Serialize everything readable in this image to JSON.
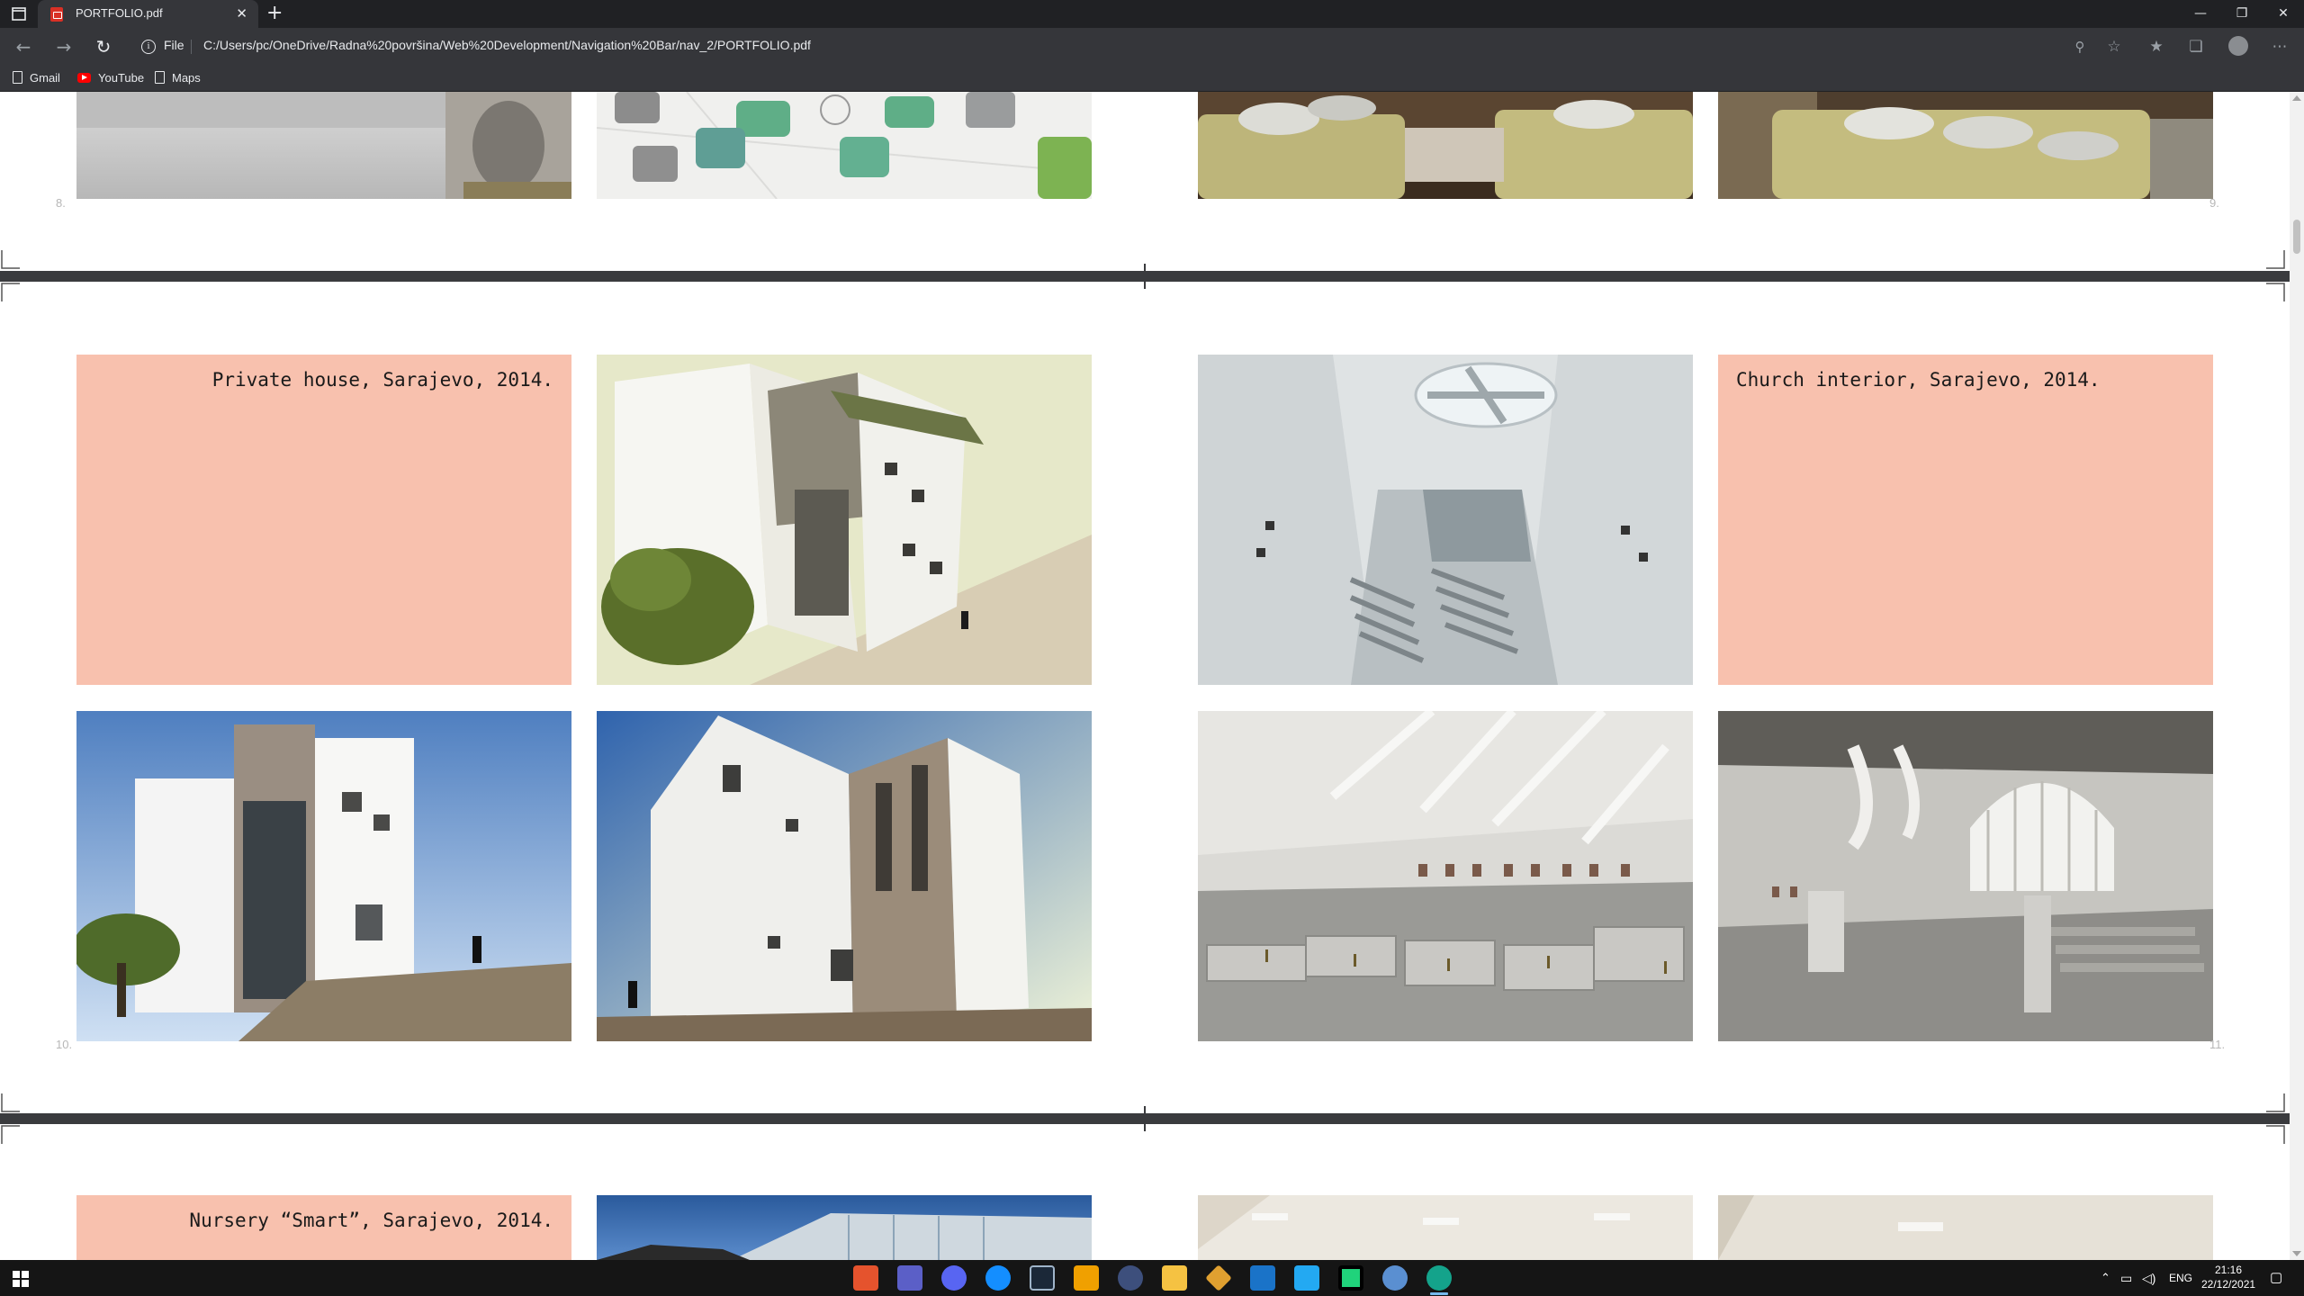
{
  "browser": {
    "tab_title": "PORTFOLIO.pdf",
    "tab_close": "✕",
    "new_tab": "+",
    "window_controls": {
      "minimize": "—",
      "maximize": "❐",
      "close": "✕"
    },
    "address": {
      "scheme_label": "File",
      "url": "C:/Users/pc/OneDrive/Radna%20površina/Web%20Development/Navigation%20Bar/nav_2/PORTFOLIO.pdf"
    },
    "bookmarks": [
      {
        "label": "Gmail",
        "icon": "document-icon"
      },
      {
        "label": "YouTube",
        "icon": "youtube-icon"
      },
      {
        "label": "Maps",
        "icon": "document-icon"
      }
    ]
  },
  "document": {
    "spreads": [
      {
        "left_page": "8.",
        "right_page": "9."
      },
      {
        "left_page": "10.",
        "right_page": "11.",
        "left_caption": "Private house, Sarajevo, 2014.",
        "right_caption": "Church interior, Sarajevo, 2014."
      },
      {
        "left_caption": "Nursery “Smart”, Sarajevo, 2014."
      }
    ]
  },
  "taskbar": {
    "clock_time": "21:16",
    "clock_date": "22/12/2021",
    "language": "ENG",
    "apps": [
      "brave-icon",
      "teams-icon",
      "discord-icon",
      "battlenet-icon",
      "steam-icon",
      "rockstar-icon",
      "obs-icon",
      "file-explorer-icon",
      "git-icon",
      "mail-icon",
      "vscode-icon",
      "pycharm-icon",
      "rstudio-icon",
      "edge-icon"
    ]
  },
  "colors": {
    "caption_panel": "#f8c1ae",
    "browser_dark": "#202124",
    "toolbar": "#35363a"
  }
}
